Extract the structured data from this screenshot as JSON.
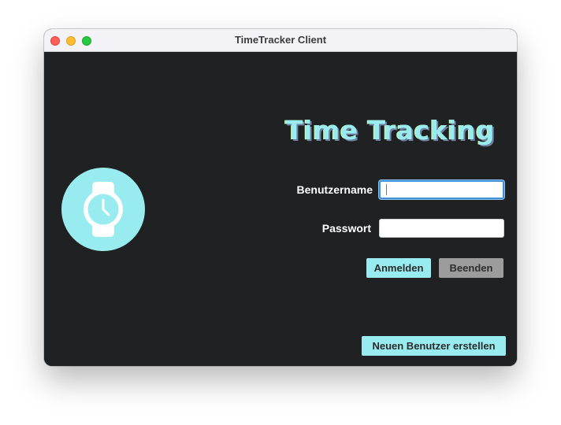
{
  "window": {
    "title": "TimeTracker Client"
  },
  "colors": {
    "accent": "#98ecf0",
    "background": "#1f2123",
    "secondary_button": "#9c9c9c"
  },
  "logo": {
    "icon": "wristwatch-icon"
  },
  "main": {
    "heading": "Time Tracking",
    "username_label": "Benutzername",
    "username_value": "",
    "password_label": "Passwort",
    "password_value": "",
    "login_button": "Anmelden",
    "quit_button": "Beenden",
    "new_user_button": "Neuen Benutzer erstellen"
  }
}
